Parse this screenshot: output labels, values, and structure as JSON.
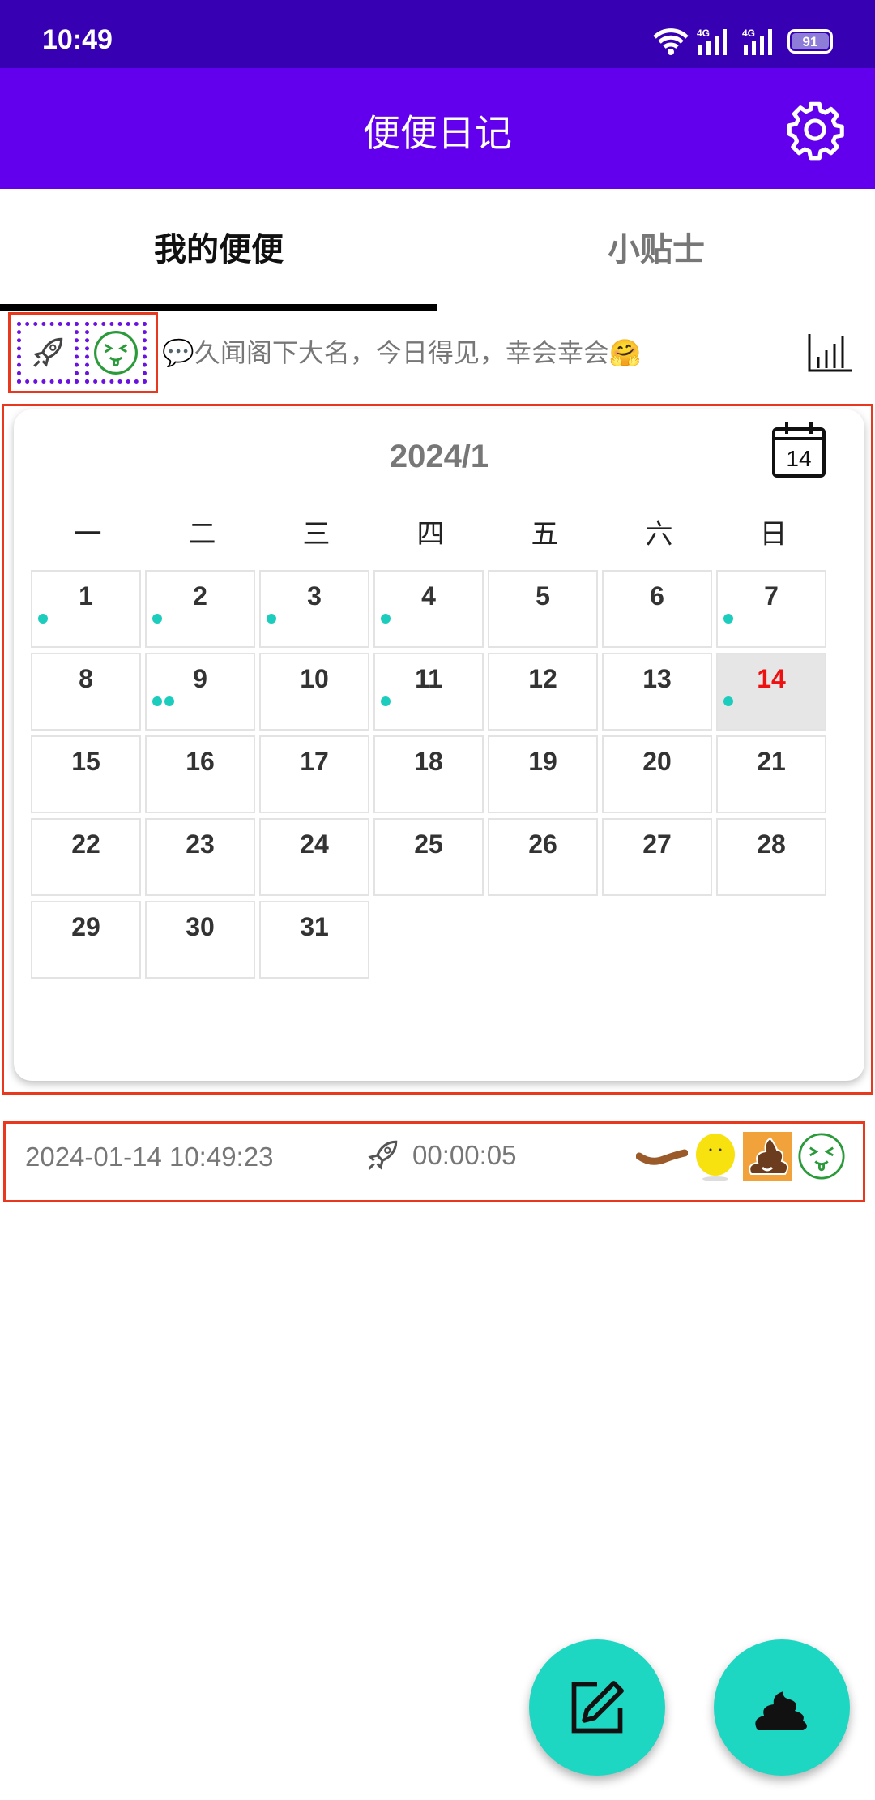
{
  "status_bar": {
    "time": "10:49",
    "network": "4G",
    "battery": "91"
  },
  "app_bar": {
    "title": "便便日记",
    "settings_icon": "gear-icon"
  },
  "tabs": [
    {
      "label": "我的便便",
      "active": true
    },
    {
      "label": "小贴士",
      "active": false
    }
  ],
  "mood_bar": {
    "selected_icons": [
      "rocket-icon",
      "squint-face-icon"
    ],
    "motto": "💬久闻阁下大名，今日得见，幸会幸会🤗",
    "stats_icon": "bar-chart-icon"
  },
  "calendar": {
    "month_title": "2024/1",
    "today_icon_label": "14",
    "weekdays": [
      "一",
      "二",
      "三",
      "四",
      "五",
      "六",
      "日"
    ],
    "days": [
      {
        "d": "1",
        "dots": 1
      },
      {
        "d": "2",
        "dots": 1
      },
      {
        "d": "3",
        "dots": 1
      },
      {
        "d": "4",
        "dots": 1
      },
      {
        "d": "5",
        "dots": 0
      },
      {
        "d": "6",
        "dots": 0
      },
      {
        "d": "7",
        "dots": 1
      },
      {
        "d": "8",
        "dots": 0
      },
      {
        "d": "9",
        "dots": 2
      },
      {
        "d": "10",
        "dots": 0
      },
      {
        "d": "11",
        "dots": 1
      },
      {
        "d": "12",
        "dots": 0
      },
      {
        "d": "13",
        "dots": 0
      },
      {
        "d": "14",
        "dots": 1,
        "today": true
      },
      {
        "d": "15",
        "dots": 0
      },
      {
        "d": "16",
        "dots": 0
      },
      {
        "d": "17",
        "dots": 0
      },
      {
        "d": "18",
        "dots": 0
      },
      {
        "d": "19",
        "dots": 0
      },
      {
        "d": "20",
        "dots": 0
      },
      {
        "d": "21",
        "dots": 0
      },
      {
        "d": "22",
        "dots": 0
      },
      {
        "d": "23",
        "dots": 0
      },
      {
        "d": "24",
        "dots": 0
      },
      {
        "d": "25",
        "dots": 0
      },
      {
        "d": "26",
        "dots": 0
      },
      {
        "d": "27",
        "dots": 0
      },
      {
        "d": "28",
        "dots": 0
      },
      {
        "d": "29",
        "dots": 0
      },
      {
        "d": "30",
        "dots": 0
      },
      {
        "d": "31",
        "dots": 0
      }
    ],
    "dot_color": "#1CCDBD",
    "today_color": "#E11111"
  },
  "record": {
    "datetime": "2024-01-14 10:49:23",
    "duration": "00:00:05",
    "tags": [
      "sausage-shape-icon",
      "yellow-color-icon",
      "poop-emoji-icon",
      "squint-face-icon"
    ]
  },
  "fabs": [
    {
      "icon": "edit-icon"
    },
    {
      "icon": "poop-icon"
    }
  ],
  "colors": {
    "status_bar": "#3700B3",
    "app_bar": "#6200EE",
    "fab": "#1ED7C2",
    "highlight_border": "#E8391E"
  }
}
